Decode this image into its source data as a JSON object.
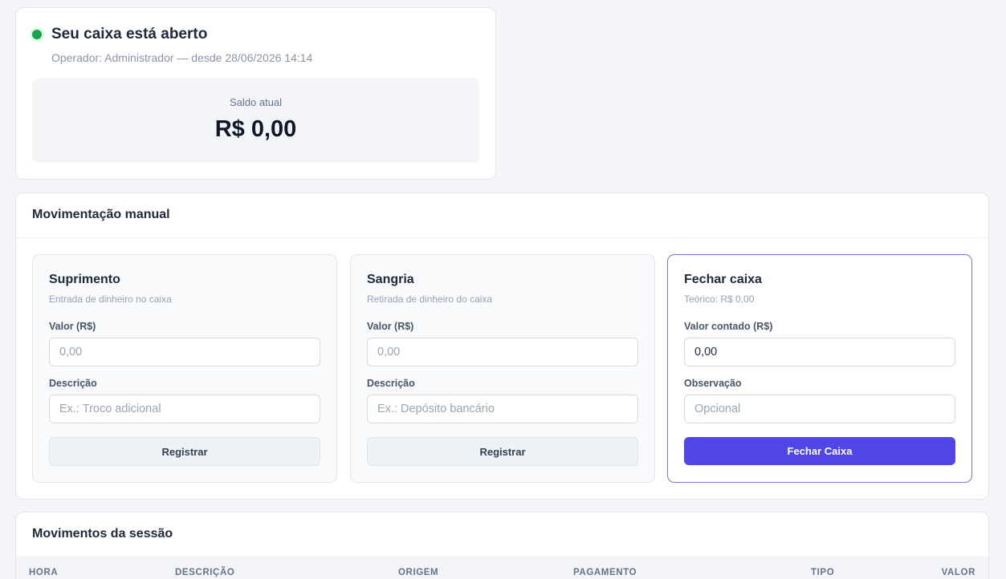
{
  "status": {
    "title": "Seu caixa está aberto",
    "subtitle": "Operador: Administrador — desde 28/06/2026 14:14",
    "balance_label": "Saldo atual",
    "balance_value": "R$ 0,00",
    "status_color": "#16a34a"
  },
  "manual": {
    "title": "Movimentação manual",
    "suprimento": {
      "title": "Suprimento",
      "subtitle": "Entrada de dinheiro no caixa",
      "value_label": "Valor (R$)",
      "value_placeholder": "0,00",
      "desc_label": "Descrição",
      "desc_placeholder": "Ex.: Troco adicional",
      "button": "Registrar"
    },
    "sangria": {
      "title": "Sangria",
      "subtitle": "Retirada de dinheiro do caixa",
      "value_label": "Valor (R$)",
      "value_placeholder": "0,00",
      "desc_label": "Descrição",
      "desc_placeholder": "Ex.: Depósito bancário",
      "button": "Registrar"
    },
    "fechar": {
      "title": "Fechar caixa",
      "subtitle": "Teórico: R$ 0,00",
      "value_label": "Valor contado (R$)",
      "value": "0,00",
      "obs_label": "Observação",
      "obs_placeholder": "Opcional",
      "button": "Fechar Caixa",
      "accent": "#4f46e5"
    }
  },
  "moves": {
    "title": "Movimentos da sessão",
    "columns": [
      "HORA",
      "DESCRIÇÃO",
      "ORIGEM",
      "PAGAMENTO",
      "TIPO",
      "VALOR"
    ]
  }
}
